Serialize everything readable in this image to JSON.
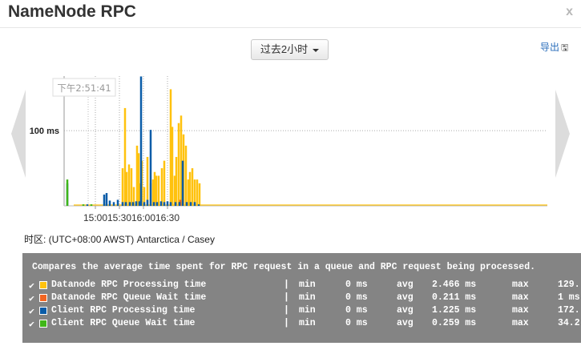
{
  "dialog": {
    "title": "NameNode RPC",
    "close_label": "x",
    "range_label": "过去2小时",
    "export_label": "导出",
    "export_icon": "floppy-disk-icon",
    "timezone": "时区: (UTC+08:00 AWST) Antarctica / Casey"
  },
  "chart_data": {
    "type": "bar",
    "ylabel": "",
    "y_tick_labels": [
      "100 ms"
    ],
    "y_ticks": [
      100
    ],
    "ylim": [
      0,
      172.5
    ],
    "x_tick_labels": [
      "15:00",
      "15:30",
      "16:00",
      "16:30"
    ],
    "hover_label": "下午2:51:41",
    "grid": true,
    "series": [
      {
        "name": "Datanode RPC Processing time",
        "color": "#ffc20e",
        "points": [
          [
            "15:34",
            50
          ],
          [
            "15:37",
            130
          ],
          [
            "15:39",
            45
          ],
          [
            "15:42",
            55
          ],
          [
            "15:45",
            50
          ],
          [
            "15:48",
            25
          ],
          [
            "15:52",
            80
          ],
          [
            "15:54",
            70
          ],
          [
            "15:56",
            30
          ],
          [
            "15:58",
            60
          ],
          [
            "16:01",
            25
          ],
          [
            "16:05",
            65
          ],
          [
            "16:09",
            30
          ],
          [
            "16:12",
            35
          ],
          [
            "16:14",
            45
          ],
          [
            "16:16",
            40
          ],
          [
            "16:19",
            40
          ],
          [
            "16:23",
            50
          ],
          [
            "16:26",
            60
          ],
          [
            "16:34",
            155
          ],
          [
            "16:36",
            105
          ],
          [
            "16:39",
            40
          ],
          [
            "16:41",
            65
          ],
          [
            "16:44",
            110
          ],
          [
            "16:47",
            120
          ],
          [
            "16:50",
            95
          ],
          [
            "16:53",
            80
          ],
          [
            "16:56",
            35
          ],
          [
            "16:58",
            45
          ],
          [
            "17:01",
            50
          ],
          [
            "17:04",
            35
          ],
          [
            "17:07",
            35
          ],
          [
            "17:10",
            30
          ]
        ]
      },
      {
        "name": "Datanode RPC Queue Wait time",
        "color": "#f26522",
        "points": [
          [
            "16:46",
            8
          ]
        ]
      },
      {
        "name": "Client RPC Processing time",
        "color": "#0a5ca8",
        "points": [
          [
            "14:25",
            30
          ],
          [
            "14:50",
            2
          ],
          [
            "15:11",
            15
          ],
          [
            "15:14",
            17
          ],
          [
            "15:18",
            7
          ],
          [
            "15:23",
            5
          ],
          [
            "15:28",
            8
          ],
          [
            "15:34",
            5
          ],
          [
            "15:38",
            5
          ],
          [
            "15:43",
            5
          ],
          [
            "15:47",
            5
          ],
          [
            "15:51",
            6
          ],
          [
            "15:55",
            6
          ],
          [
            "15:57",
            172
          ],
          [
            "16:01",
            5
          ],
          [
            "16:05",
            8
          ],
          [
            "16:09",
            101
          ],
          [
            "16:13",
            5
          ],
          [
            "16:17",
            5
          ],
          [
            "16:22",
            6
          ],
          [
            "16:26",
            5
          ],
          [
            "16:30",
            6
          ],
          [
            "16:34",
            5
          ],
          [
            "16:40",
            5
          ],
          [
            "16:45",
            5
          ],
          [
            "16:49",
            60
          ],
          [
            "16:54",
            5
          ],
          [
            "16:59",
            5
          ],
          [
            "17:04",
            5
          ],
          [
            "17:09",
            2
          ]
        ]
      },
      {
        "name": "Client RPC Queue Wait time",
        "color": "#3fb618",
        "points": [
          [
            "14:25",
            35
          ],
          [
            "14:45",
            2
          ],
          [
            "14:55",
            2
          ]
        ]
      }
    ]
  },
  "legend": {
    "description": "Compares the average time spent for RPC request in a queue and RPC request being processed.",
    "rows": [
      {
        "check": "✔",
        "color": "#ffc20e",
        "name": "Datanode RPC Processing time",
        "sep": "|",
        "min_label": "min",
        "min": "0 ms",
        "avg_label": "avg",
        "avg": "2.466 ms",
        "max_label": "max",
        "max": "129."
      },
      {
        "check": "✔",
        "color": "#f26522",
        "name": "Datanode RPC Queue Wait time",
        "sep": "|",
        "min_label": "min",
        "min": "0 ms",
        "avg_label": "avg",
        "avg": "0.211 ms",
        "max_label": "max",
        "max": "1 ms"
      },
      {
        "check": "✔",
        "color": "#0a5ca8",
        "name": "Client RPC Processing time",
        "sep": "|",
        "min_label": "min",
        "min": "0 ms",
        "avg_label": "avg",
        "avg": "1.225 ms",
        "max_label": "max",
        "max": "172."
      },
      {
        "check": "✔",
        "color": "#3fb618",
        "name": "Client RPC Queue Wait time",
        "sep": "|",
        "min_label": "min",
        "min": "0 ms",
        "avg_label": "avg",
        "avg": "0.259 ms",
        "max_label": "max",
        "max": "34.2"
      }
    ]
  }
}
